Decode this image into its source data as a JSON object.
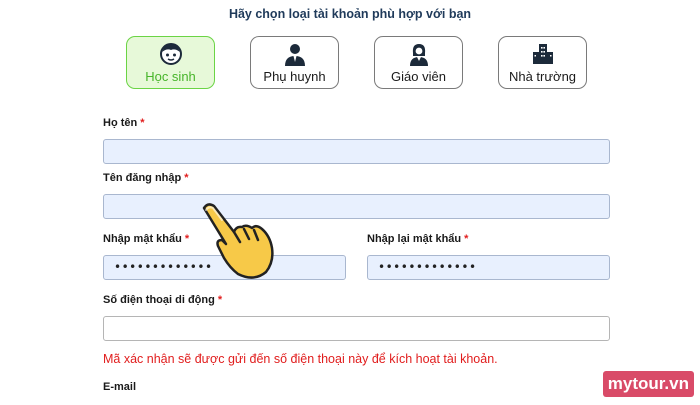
{
  "heading": "Hãy chọn loại tài khoản phù hợp với bạn",
  "account_types": [
    {
      "label": "Học sinh",
      "icon": "student-icon",
      "selected": true
    },
    {
      "label": "Phụ huynh",
      "icon": "parent-icon",
      "selected": false
    },
    {
      "label": "Giáo viên",
      "icon": "teacher-icon",
      "selected": false
    },
    {
      "label": "Nhà trường",
      "icon": "school-icon",
      "selected": false
    }
  ],
  "form": {
    "full_name": {
      "label": "Họ tên",
      "required": "*",
      "value": ""
    },
    "username": {
      "label": "Tên đăng nhập",
      "required": "*",
      "value": ""
    },
    "password": {
      "label": "Nhập mật khẩu",
      "required": "*",
      "value": "•••••••••••••"
    },
    "confirm_password": {
      "label": "Nhập lại mật khẩu",
      "required": "*",
      "value": "•••••••••••••"
    },
    "phone": {
      "label": "Số điện thoại di động",
      "required": "*",
      "value": ""
    },
    "phone_notice": "Mã xác nhận sẽ được gửi đến số điện thoại này để kích hoạt tài khoản.",
    "email": {
      "label": "E-mail"
    }
  },
  "watermark": "mytour.vn",
  "colors": {
    "selected_border": "#6bd445",
    "selected_bg": "#e7f9d9",
    "selected_text": "#47b52a",
    "field_bg": "#e8f0fe",
    "required": "#e11d1d",
    "watermark_bg": "#d94b68"
  }
}
